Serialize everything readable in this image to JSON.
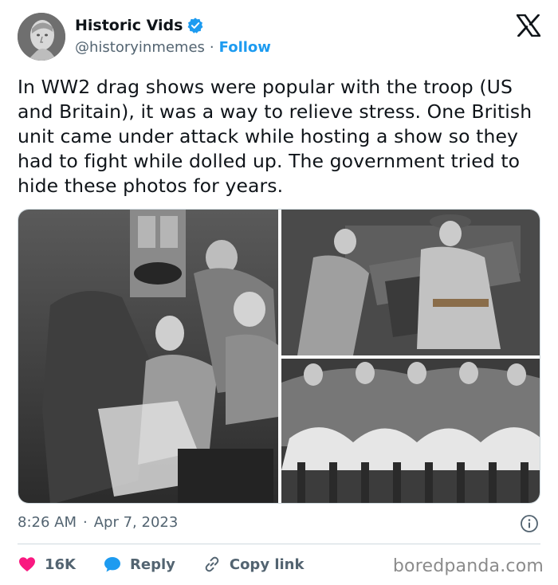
{
  "tweet": {
    "author_name": "Historic Vids",
    "author_handle": "@historyinmemes",
    "separator": "·",
    "follow_label": "Follow",
    "text": "In WW2 drag shows were popular with the troop (US and Britain), it was a way to relieve stress. One British unit came under attack while hosting a show so they had to fight while dolled up. The government tried to hide these photos for years.",
    "time": "8:26 AM",
    "date": "Apr 7, 2023",
    "date_separator": "·"
  },
  "actions": {
    "likes_count": "16K",
    "reply_label": "Reply",
    "copy_link_label": "Copy link"
  },
  "watermark": "boredpanda.com",
  "colors": {
    "accent": "#1d9bf0",
    "like": "#f91880",
    "text": "#0f1419",
    "muted": "#536471"
  },
  "icons": {
    "verified": "verified-badge-icon",
    "brand": "x-logo-icon",
    "info": "info-icon",
    "like": "heart-icon",
    "reply": "speech-bubble-icon",
    "copy": "link-icon"
  }
}
